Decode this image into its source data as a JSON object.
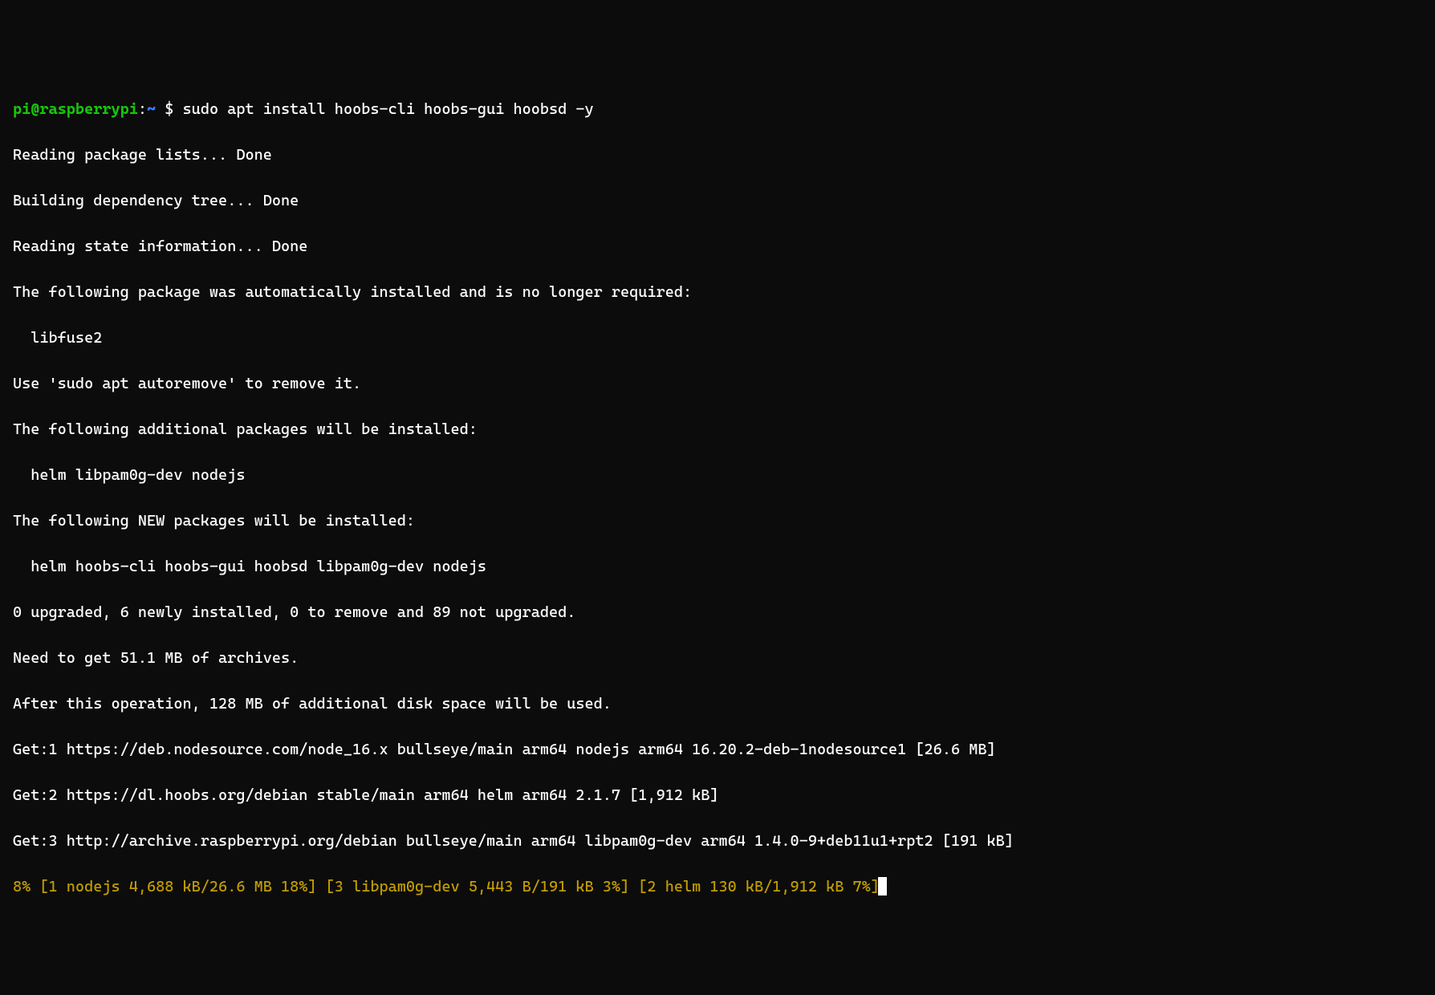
{
  "prompt": {
    "user_host": "pi@raspberrypi",
    "separator": ":",
    "path": "~",
    "symbol": " $ "
  },
  "command": "sudo apt install hoobs-cli hoobs-gui hoobsd -y",
  "output_lines": [
    "Reading package lists... Done",
    "Building dependency tree... Done",
    "Reading state information... Done",
    "The following package was automatically installed and is no longer required:",
    "  libfuse2",
    "Use 'sudo apt autoremove' to remove it.",
    "The following additional packages will be installed:",
    "  helm libpam0g-dev nodejs",
    "The following NEW packages will be installed:",
    "  helm hoobs-cli hoobs-gui hoobsd libpam0g-dev nodejs",
    "0 upgraded, 6 newly installed, 0 to remove and 89 not upgraded.",
    "Need to get 51.1 MB of archives.",
    "After this operation, 128 MB of additional disk space will be used.",
    "Get:1 https://deb.nodesource.com/node_16.x bullseye/main arm64 nodejs arm64 16.20.2-deb-1nodesource1 [26.6 MB]",
    "Get:2 https://dl.hoobs.org/debian stable/main arm64 helm arm64 2.1.7 [1,912 kB]",
    "Get:3 http://archive.raspberrypi.org/debian bullseye/main arm64 libpam0g-dev arm64 1.4.0-9+deb11u1+rpt2 [191 kB]"
  ],
  "progress_line": "8% [1 nodejs 4,688 kB/26.6 MB 18%] [3 libpam0g-dev 5,443 B/191 kB 3%] [2 helm 130 kB/1,912 kB 7%]"
}
